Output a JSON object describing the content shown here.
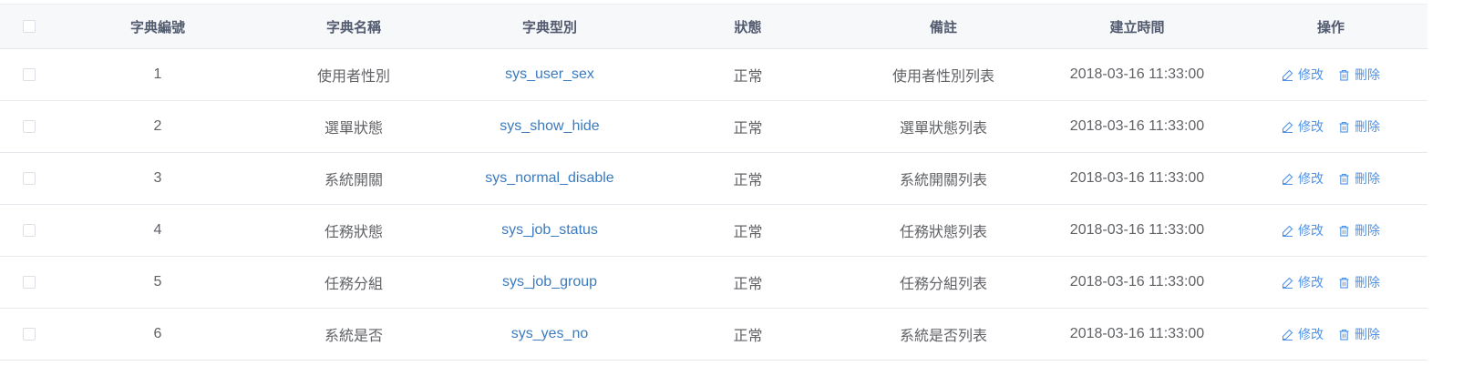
{
  "columns": {
    "id": "字典編號",
    "name": "字典名稱",
    "type": "字典型別",
    "status": "狀態",
    "remark": "備註",
    "created": "建立時間",
    "ops": "操作"
  },
  "actions": {
    "edit_label": "修改",
    "delete_label": "刪除",
    "edit_icon": "edit-icon",
    "delete_icon": "trash-icon"
  },
  "colors": {
    "link": "#3b7bbf",
    "action": "#4f92e6",
    "header_bg": "#f7f8fa"
  },
  "rows": [
    {
      "id": "1",
      "name": "使用者性別",
      "type": "sys_user_sex",
      "status": "正常",
      "remark": "使用者性別列表",
      "created": "2018-03-16 11:33:00"
    },
    {
      "id": "2",
      "name": "選單狀態",
      "type": "sys_show_hide",
      "status": "正常",
      "remark": "選單狀態列表",
      "created": "2018-03-16 11:33:00"
    },
    {
      "id": "3",
      "name": "系統開關",
      "type": "sys_normal_disable",
      "status": "正常",
      "remark": "系統開關列表",
      "created": "2018-03-16 11:33:00"
    },
    {
      "id": "4",
      "name": "任務狀態",
      "type": "sys_job_status",
      "status": "正常",
      "remark": "任務狀態列表",
      "created": "2018-03-16 11:33:00"
    },
    {
      "id": "5",
      "name": "任務分組",
      "type": "sys_job_group",
      "status": "正常",
      "remark": "任務分組列表",
      "created": "2018-03-16 11:33:00"
    },
    {
      "id": "6",
      "name": "系統是否",
      "type": "sys_yes_no",
      "status": "正常",
      "remark": "系統是否列表",
      "created": "2018-03-16 11:33:00"
    }
  ]
}
